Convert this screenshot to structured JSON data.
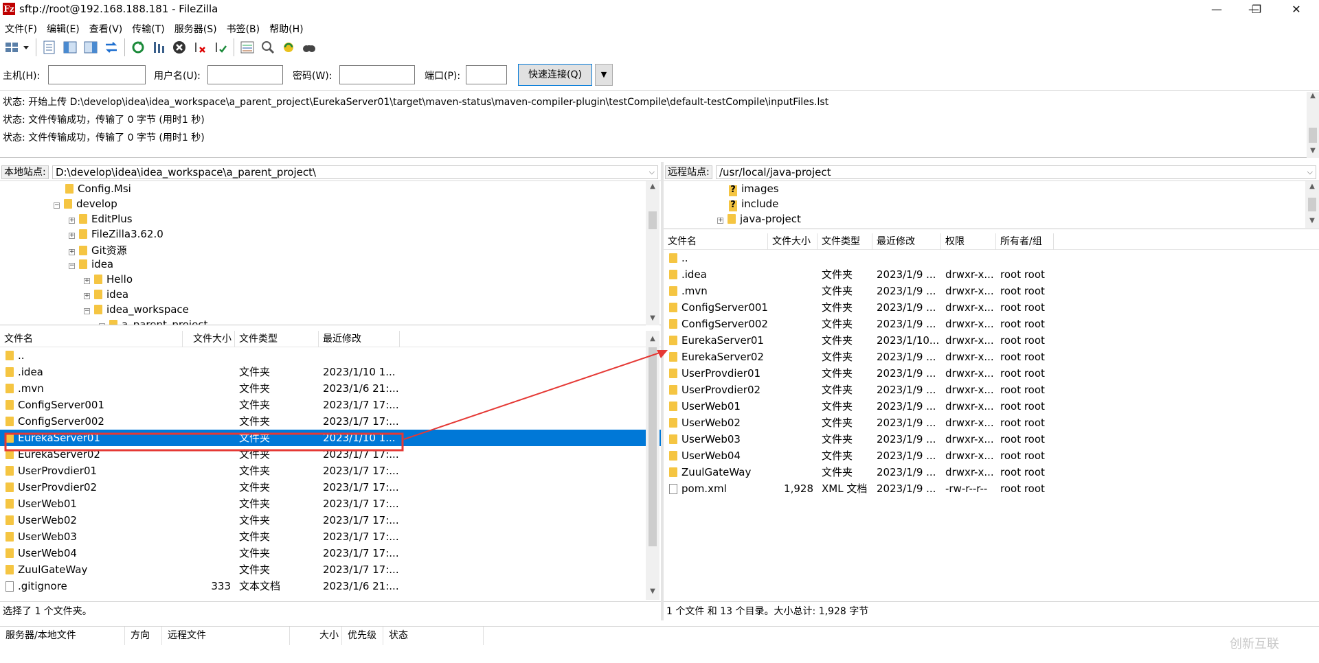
{
  "window": {
    "title": "sftp://root@192.168.188.181 - FileZilla",
    "minimize": "—",
    "maximize": "❐",
    "close": "✕"
  },
  "menu": [
    "文件(F)",
    "编辑(E)",
    "查看(V)",
    "传输(T)",
    "服务器(S)",
    "书签(B)",
    "帮助(H)"
  ],
  "quickconnect": {
    "host_label": "主机(H):",
    "user_label": "用户名(U):",
    "pass_label": "密码(W):",
    "port_label": "端口(P):",
    "host_value": "",
    "user_value": "",
    "pass_value": "",
    "port_value": "",
    "connect_button": "快速连接(Q)"
  },
  "log": [
    "状态:  开始上传 D:\\develop\\idea\\idea_workspace\\a_parent_project\\EurekaServer01\\target\\maven-status\\maven-compiler-plugin\\testCompile\\default-testCompile\\inputFiles.lst",
    "状态:  文件传输成功，传输了 0 字节 (用时1 秒)",
    "状态:  文件传输成功，传输了 0 字节 (用时1 秒)"
  ],
  "local": {
    "site_label": "本地站点:",
    "path": "D:\\develop\\idea\\idea_workspace\\a_parent_project\\",
    "tree": [
      {
        "name": "Config.Msi",
        "indent": 0,
        "expander": ""
      },
      {
        "name": "develop",
        "indent": 0,
        "expander": "−"
      },
      {
        "name": "EditPlus",
        "indent": 1,
        "expander": "+"
      },
      {
        "name": "FileZilla3.62.0",
        "indent": 1,
        "expander": "+"
      },
      {
        "name": "Git资源",
        "indent": 1,
        "expander": "+"
      },
      {
        "name": "idea",
        "indent": 1,
        "expander": "−"
      },
      {
        "name": "Hello",
        "indent": 2,
        "expander": "+"
      },
      {
        "name": "idea",
        "indent": 2,
        "expander": "+"
      },
      {
        "name": "idea_workspace",
        "indent": 2,
        "expander": "−"
      },
      {
        "name": "a_parent_project",
        "indent": 3,
        "expander": "−"
      }
    ],
    "columns": [
      "文件名",
      "文件大小",
      "文件类型",
      "最近修改"
    ],
    "files": [
      {
        "name": "..",
        "size": "",
        "type": "",
        "modified": "",
        "kind": "folder"
      },
      {
        "name": ".idea",
        "size": "",
        "type": "文件夹",
        "modified": "2023/1/10 1...",
        "kind": "folder"
      },
      {
        "name": ".mvn",
        "size": "",
        "type": "文件夹",
        "modified": "2023/1/6 21:...",
        "kind": "folder"
      },
      {
        "name": "ConfigServer001",
        "size": "",
        "type": "文件夹",
        "modified": "2023/1/7 17:...",
        "kind": "folder"
      },
      {
        "name": "ConfigServer002",
        "size": "",
        "type": "文件夹",
        "modified": "2023/1/7 17:...",
        "kind": "folder"
      },
      {
        "name": "EurekaServer01",
        "size": "",
        "type": "文件夹",
        "modified": "2023/1/10 1...",
        "kind": "folder",
        "selected": true
      },
      {
        "name": "EurekaServer02",
        "size": "",
        "type": "文件夹",
        "modified": "2023/1/7 17:...",
        "kind": "folder"
      },
      {
        "name": "UserProvdier01",
        "size": "",
        "type": "文件夹",
        "modified": "2023/1/7 17:...",
        "kind": "folder"
      },
      {
        "name": "UserProvdier02",
        "size": "",
        "type": "文件夹",
        "modified": "2023/1/7 17:...",
        "kind": "folder"
      },
      {
        "name": "UserWeb01",
        "size": "",
        "type": "文件夹",
        "modified": "2023/1/7 17:...",
        "kind": "folder"
      },
      {
        "name": "UserWeb02",
        "size": "",
        "type": "文件夹",
        "modified": "2023/1/7 17:...",
        "kind": "folder"
      },
      {
        "name": "UserWeb03",
        "size": "",
        "type": "文件夹",
        "modified": "2023/1/7 17:...",
        "kind": "folder"
      },
      {
        "name": "UserWeb04",
        "size": "",
        "type": "文件夹",
        "modified": "2023/1/7 17:...",
        "kind": "folder"
      },
      {
        "name": "ZuulGateWay",
        "size": "",
        "type": "文件夹",
        "modified": "2023/1/7 17:...",
        "kind": "folder"
      },
      {
        "name": ".gitignore",
        "size": "333",
        "type": "文本文档",
        "modified": "2023/1/6 21:...",
        "kind": "file"
      }
    ],
    "status": "选择了 1 个文件夹。"
  },
  "remote": {
    "site_label": "远程站点:",
    "path": "/usr/local/java-project",
    "tree": [
      {
        "name": "images",
        "icon": "unknown",
        "expander": ""
      },
      {
        "name": "include",
        "icon": "unknown",
        "expander": ""
      },
      {
        "name": "java-project",
        "icon": "folder",
        "expander": "+"
      }
    ],
    "columns": [
      "文件名",
      "文件大小",
      "文件类型",
      "最近修改",
      "权限",
      "所有者/组"
    ],
    "files": [
      {
        "name": "..",
        "size": "",
        "type": "",
        "modified": "",
        "perm": "",
        "owner": "",
        "kind": "folder"
      },
      {
        "name": ".idea",
        "size": "",
        "type": "文件夹",
        "modified": "2023/1/9 ...",
        "perm": "drwxr-x...",
        "owner": "root root",
        "kind": "folder"
      },
      {
        "name": ".mvn",
        "size": "",
        "type": "文件夹",
        "modified": "2023/1/9 ...",
        "perm": "drwxr-x...",
        "owner": "root root",
        "kind": "folder"
      },
      {
        "name": "ConfigServer001",
        "size": "",
        "type": "文件夹",
        "modified": "2023/1/9 ...",
        "perm": "drwxr-x...",
        "owner": "root root",
        "kind": "folder"
      },
      {
        "name": "ConfigServer002",
        "size": "",
        "type": "文件夹",
        "modified": "2023/1/9 ...",
        "perm": "drwxr-x...",
        "owner": "root root",
        "kind": "folder"
      },
      {
        "name": "EurekaServer01",
        "size": "",
        "type": "文件夹",
        "modified": "2023/1/10...",
        "perm": "drwxr-x...",
        "owner": "root root",
        "kind": "folder"
      },
      {
        "name": "EurekaServer02",
        "size": "",
        "type": "文件夹",
        "modified": "2023/1/9 ...",
        "perm": "drwxr-x...",
        "owner": "root root",
        "kind": "folder"
      },
      {
        "name": "UserProvdier01",
        "size": "",
        "type": "文件夹",
        "modified": "2023/1/9 ...",
        "perm": "drwxr-x...",
        "owner": "root root",
        "kind": "folder"
      },
      {
        "name": "UserProvdier02",
        "size": "",
        "type": "文件夹",
        "modified": "2023/1/9 ...",
        "perm": "drwxr-x...",
        "owner": "root root",
        "kind": "folder"
      },
      {
        "name": "UserWeb01",
        "size": "",
        "type": "文件夹",
        "modified": "2023/1/9 ...",
        "perm": "drwxr-x...",
        "owner": "root root",
        "kind": "folder"
      },
      {
        "name": "UserWeb02",
        "size": "",
        "type": "文件夹",
        "modified": "2023/1/9 ...",
        "perm": "drwxr-x...",
        "owner": "root root",
        "kind": "folder"
      },
      {
        "name": "UserWeb03",
        "size": "",
        "type": "文件夹",
        "modified": "2023/1/9 ...",
        "perm": "drwxr-x...",
        "owner": "root root",
        "kind": "folder"
      },
      {
        "name": "UserWeb04",
        "size": "",
        "type": "文件夹",
        "modified": "2023/1/9 ...",
        "perm": "drwxr-x...",
        "owner": "root root",
        "kind": "folder"
      },
      {
        "name": "ZuulGateWay",
        "size": "",
        "type": "文件夹",
        "modified": "2023/1/9 ...",
        "perm": "drwxr-x...",
        "owner": "root root",
        "kind": "folder"
      },
      {
        "name": "pom.xml",
        "size": "1,928",
        "type": "XML 文档",
        "modified": "2023/1/9 ...",
        "perm": "-rw-r--r--",
        "owner": "root root",
        "kind": "file"
      }
    ],
    "status": "1 个文件 和 13 个目录。大小总计: 1,928 字节"
  },
  "queue": {
    "columns": [
      "服务器/本地文件",
      "方向",
      "远程文件",
      "大小",
      "优先级",
      "状态"
    ]
  },
  "watermark": "创新互联",
  "colors": {
    "selection": "#0078d7",
    "annotation": "#e53935",
    "folder": "#f5c542"
  }
}
